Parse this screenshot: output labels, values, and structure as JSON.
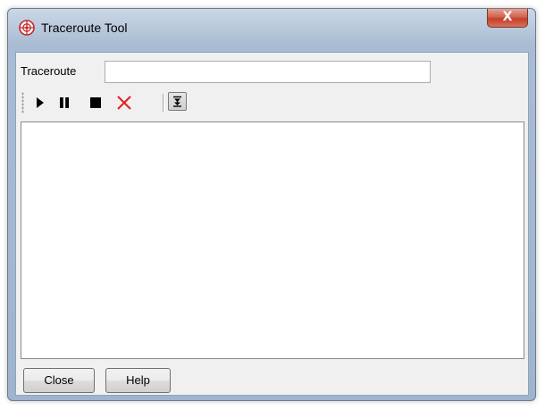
{
  "window": {
    "title": "Traceroute Tool",
    "close_glyph": "X",
    "icon": "globe-icon",
    "accent_color": "#d0634e"
  },
  "form": {
    "label": "Traceroute",
    "value": "",
    "placeholder": ""
  },
  "toolbar": {
    "items": [
      {
        "name": "play-icon",
        "title": "Start"
      },
      {
        "name": "pause-icon",
        "title": "Pause"
      },
      {
        "name": "stop-icon",
        "title": "Stop"
      },
      {
        "name": "clear-icon",
        "title": "Clear"
      },
      {
        "name": "scroll-lock-icon",
        "title": "Auto scroll"
      }
    ]
  },
  "output": {
    "text": ""
  },
  "footer": {
    "close_label": "Close",
    "help_label": "Help"
  }
}
